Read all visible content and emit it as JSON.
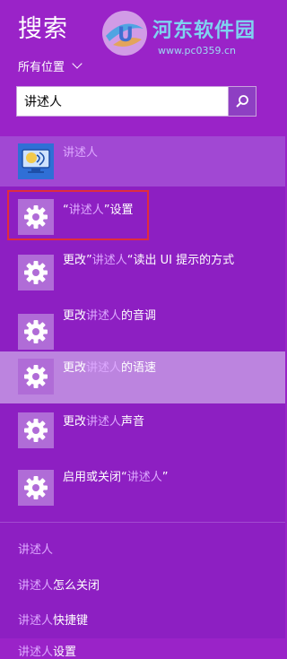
{
  "header": {
    "title": "搜索",
    "scope_label": "所有位置"
  },
  "watermark": {
    "site_name": "河东软件园",
    "url": "www.pc0359.cn"
  },
  "search": {
    "query": "讲述人"
  },
  "results": [
    {
      "icon": "narrator-app-icon",
      "pre": "",
      "hl": "讲述人",
      "post": ""
    },
    {
      "icon": "settings-gear-icon",
      "pre": "“",
      "hl": "讲述人",
      "post": "”设置"
    },
    {
      "icon": "settings-gear-icon",
      "pre": "更改”",
      "hl": "讲述人",
      "post": "“读出 UI 提示的方式"
    },
    {
      "icon": "settings-gear-icon",
      "pre": "更改",
      "hl": "讲述人",
      "post": "的音调"
    },
    {
      "icon": "settings-gear-icon",
      "pre": "更改",
      "hl": "讲述人",
      "post": "的语速"
    },
    {
      "icon": "settings-gear-icon",
      "pre": "更改",
      "hl": "讲述人",
      "post": "声音"
    },
    {
      "icon": "settings-gear-icon",
      "pre": "启用或关闭“",
      "hl": "讲述人",
      "post": "”"
    }
  ],
  "suggestions": [
    {
      "hl": "讲述人",
      "post": ""
    },
    {
      "hl": "讲述人",
      "post": "怎么关闭"
    },
    {
      "hl": "讲述人",
      "post": "快捷键"
    },
    {
      "hl": "讲述人",
      "post": "设置"
    }
  ],
  "colors": {
    "background": "#9a23c8",
    "results_background": "#8d1fc2",
    "highlight_text": "#dda8ff",
    "active_row": "#bc84df",
    "annotation_box": "#e02d3d"
  }
}
